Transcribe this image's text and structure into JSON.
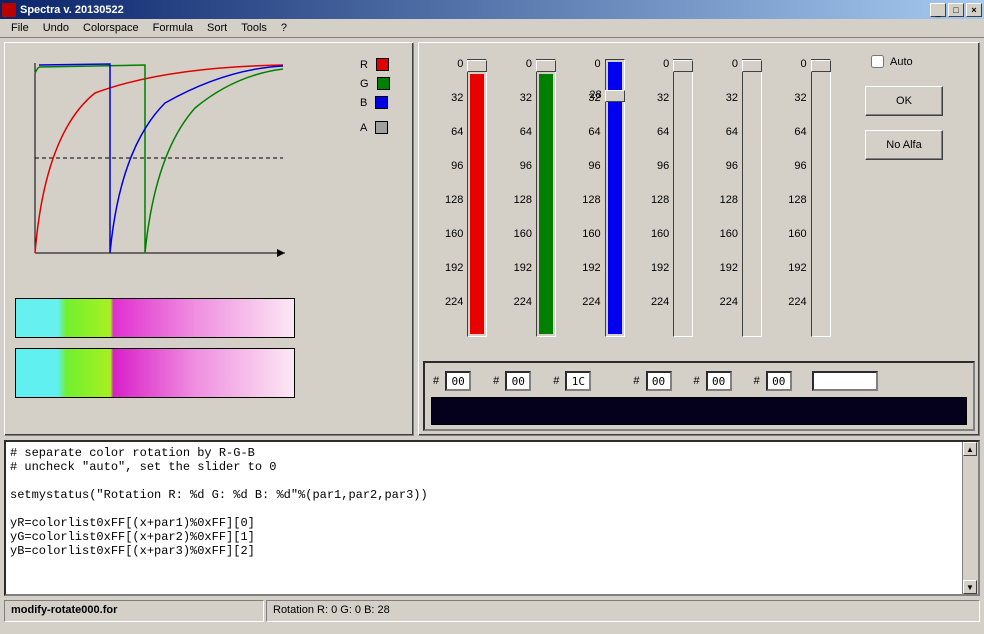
{
  "window": {
    "title": "Spectra v. 20130522",
    "min": "_",
    "max": "□",
    "close": "×"
  },
  "menu": [
    "File",
    "Undo",
    "Colorspace",
    "Formula",
    "Sort",
    "Tools",
    "?"
  ],
  "legend": [
    {
      "label": "R",
      "color": "#e00000"
    },
    {
      "label": "G",
      "color": "#008000"
    },
    {
      "label": "B",
      "color": "#0000e0"
    },
    {
      "label": "A",
      "color": "#a0a0a0"
    }
  ],
  "slider_ticks": [
    "0",
    "32",
    "64",
    "96",
    "128",
    "160",
    "192",
    "224"
  ],
  "sliders": [
    {
      "fill": "#e80000",
      "fillTop": 14,
      "thumb": 0,
      "val": null
    },
    {
      "fill": "#008000",
      "fillTop": 14,
      "thumb": 0,
      "val": null
    },
    {
      "fill": "#0000f0",
      "fillTop": 0,
      "thumb": 30,
      "val": "28"
    },
    {
      "fill": null,
      "fillTop": 14,
      "thumb": 0,
      "val": null
    },
    {
      "fill": null,
      "fillTop": 14,
      "thumb": 0,
      "val": null
    },
    {
      "fill": null,
      "fillTop": 14,
      "thumb": 0,
      "val": null
    }
  ],
  "auto_label": "Auto",
  "buttons": {
    "ok": "OK",
    "noalfa": "No Alfa"
  },
  "hex": {
    "r": "00",
    "g": "00",
    "b": "1C",
    "a": "00",
    "x1": "00",
    "x2": "00"
  },
  "preview_color": "#05001c",
  "code": "# separate color rotation by R-G-B\n# uncheck \"auto\", set the slider to 0\n\nsetmystatus(\"Rotation R: %d G: %d B: %d\"%(par1,par2,par3))\n\nyR=colorlist0xFF[(x+par1)%0xFF][0]\nyG=colorlist0xFF[(x+par2)%0xFF][1]\nyB=colorlist0xFF[(x+par3)%0xFF][2]",
  "status": {
    "file": "modify-rotate000.for",
    "msg": "Rotation R: 0 G: 0 B: 28"
  },
  "chart_data": {
    "type": "line",
    "title": "",
    "xlabel": "",
    "ylabel": "",
    "xlim": [
      0,
      255
    ],
    "ylim": [
      0,
      255
    ],
    "hline": 128,
    "series": [
      {
        "name": "R",
        "color": "#e00000",
        "wrap_at": null,
        "curve": "log"
      },
      {
        "name": "G",
        "color": "#008000",
        "wrap_at": 110,
        "curve": "log"
      },
      {
        "name": "B",
        "color": "#0000e0",
        "wrap_at": 75,
        "curve": "log"
      }
    ],
    "gradient_stops": [
      {
        "pos": 0.0,
        "color": "#66f0f0"
      },
      {
        "pos": 0.18,
        "color": "#66f050"
      },
      {
        "pos": 0.35,
        "color": "#a0f020"
      },
      {
        "pos": 0.36,
        "color": "#e030d0"
      },
      {
        "pos": 0.7,
        "color": "#f0a0e0"
      },
      {
        "pos": 1.0,
        "color": "#fce8f5"
      }
    ]
  }
}
